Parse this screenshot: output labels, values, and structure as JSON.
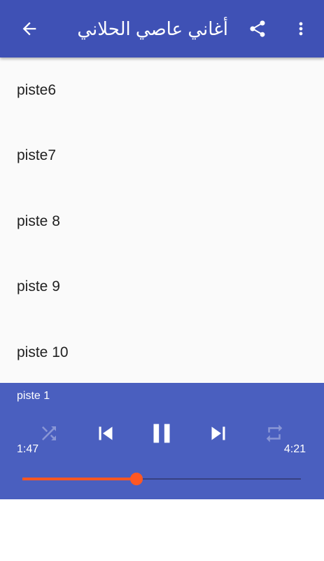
{
  "appbar": {
    "title": "أغاني عاصي الحلاني",
    "icons": {
      "back": "arrow-back-icon",
      "share": "share-icon",
      "more": "more-vert-icon"
    }
  },
  "tracks": [
    {
      "label": "piste6"
    },
    {
      "label": "piste7"
    },
    {
      "label": "piste 8"
    },
    {
      "label": "piste 9"
    },
    {
      "label": "piste 10"
    }
  ],
  "player": {
    "current_track": "piste 1",
    "elapsed": "1:47",
    "total": "4:21",
    "progress_fraction": 0.41,
    "controls": [
      "shuffle-icon",
      "skip-previous-icon",
      "pause-icon",
      "skip-next-icon",
      "repeat-icon"
    ]
  },
  "colors": {
    "primary": "#3f51b5",
    "player_bg": "#4a5fbf",
    "accent": "#ff5722",
    "background": "#fafafa"
  }
}
